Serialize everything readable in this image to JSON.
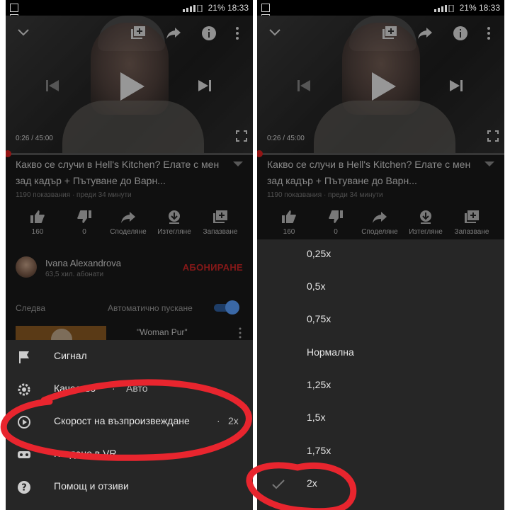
{
  "statusbar": {
    "battery": "21%",
    "time": "18:33"
  },
  "video": {
    "time_text": "0:26 / 45:00",
    "progress": 0.0096
  },
  "title": "Какво се случи в Hell's Kitchen? Елате с мен зад кадър + Пътуване до Варн...",
  "meta": "1190 показвания · преди 34 минути",
  "actions": [
    {
      "icon": "thumbs-up-icon",
      "label": "160"
    },
    {
      "icon": "thumbs-down-icon",
      "label": "0"
    },
    {
      "icon": "share-icon",
      "label": "Споделяне"
    },
    {
      "icon": "download-icon",
      "label": "Изтегляне"
    },
    {
      "icon": "save-icon",
      "label": "Запазване"
    }
  ],
  "channel": {
    "name": "Ivana Alexandrova",
    "subscribers": "63,5 хил. абонати",
    "subscribe": "АБОНИРАНЕ"
  },
  "upnext": {
    "label": "Следва",
    "autoplay": "Автоматично пускане",
    "next_title": "\"Woman Pur\""
  },
  "menu": [
    {
      "icon": "flag-icon",
      "label": "Сигнал"
    },
    {
      "icon": "gear-icon",
      "label": "Качество",
      "value": "Авто"
    },
    {
      "icon": "playback-speed-icon",
      "label": "Скорост на възпроизвеждане",
      "value": "2x"
    },
    {
      "icon": "vr-icon",
      "label": "Гледане в VR"
    },
    {
      "icon": "help-icon",
      "label": "Помощ и отзиви"
    }
  ],
  "speeds": [
    {
      "label": "0,25x",
      "selected": false
    },
    {
      "label": "0,5x",
      "selected": false
    },
    {
      "label": "0,75x",
      "selected": false
    },
    {
      "label": "Нормална",
      "selected": false
    },
    {
      "label": "1,25x",
      "selected": false
    },
    {
      "label": "1,5x",
      "selected": false
    },
    {
      "label": "1,75x",
      "selected": false
    },
    {
      "label": "2x",
      "selected": true
    }
  ],
  "colors": {
    "accent_red": "#e02020",
    "subscribe_red": "#cc2626",
    "toggle_blue": "#5aa0ff",
    "annotation_red": "#e8252e"
  }
}
